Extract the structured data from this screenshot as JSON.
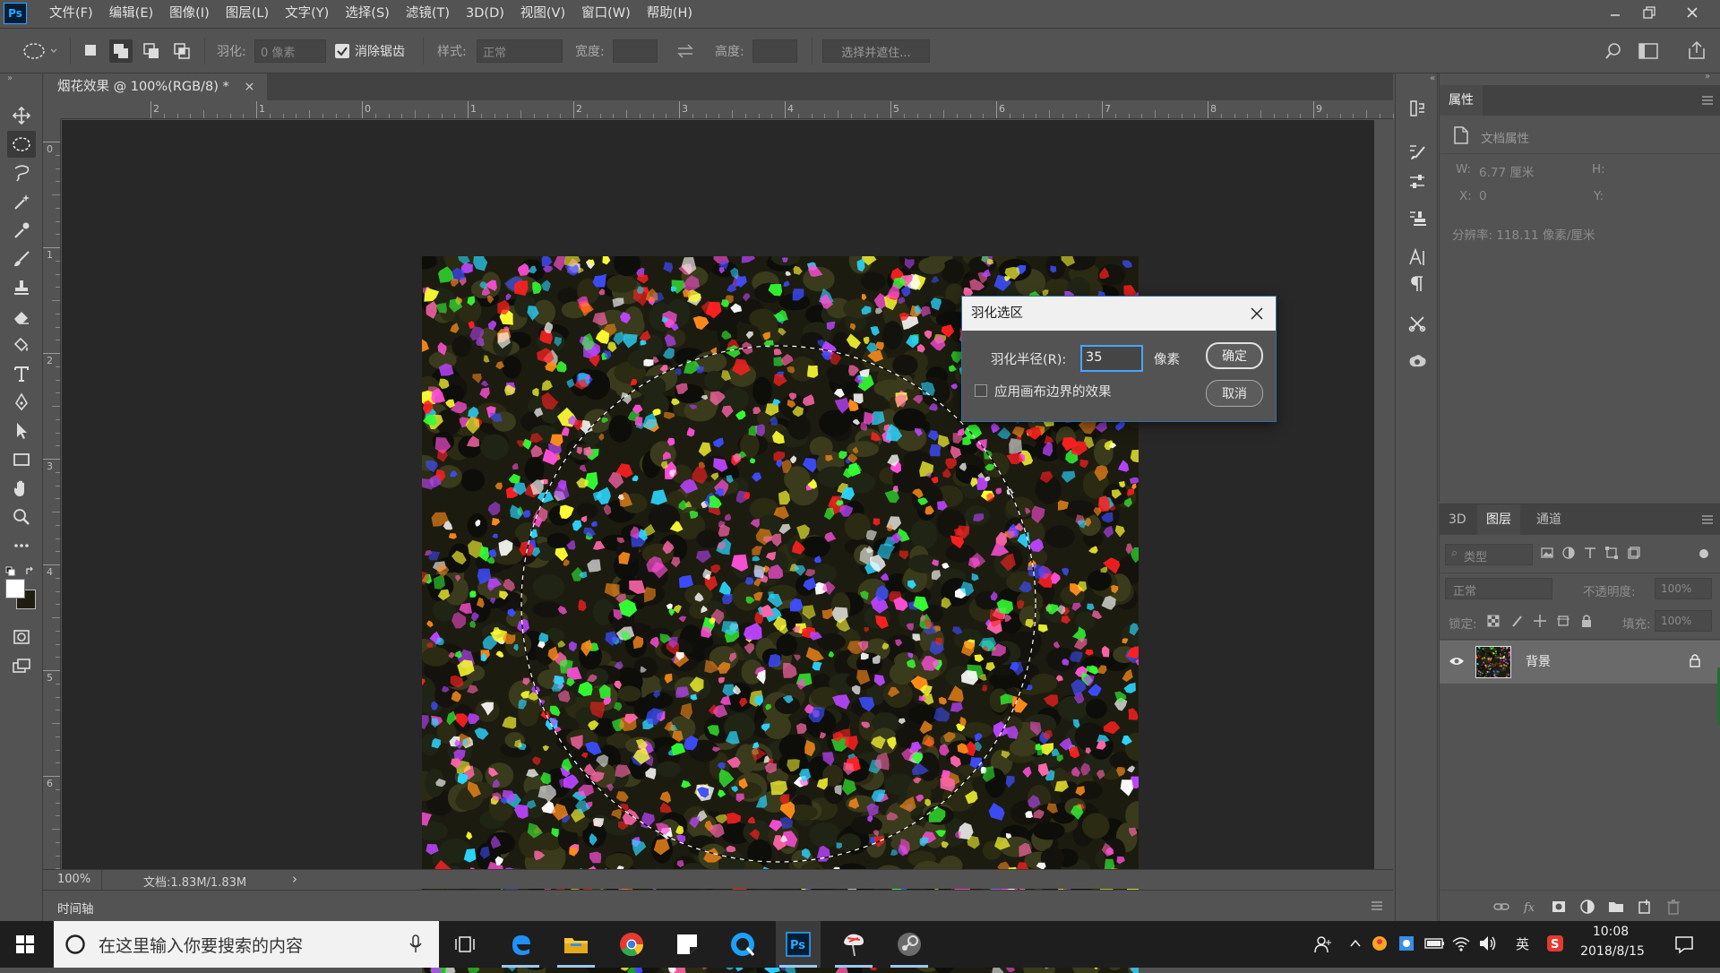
{
  "app": {
    "logo": "Ps",
    "window_controls": [
      "minimize-icon",
      "restore-icon",
      "close-icon"
    ]
  },
  "menu": [
    "文件(F)",
    "编辑(E)",
    "图像(I)",
    "图层(L)",
    "文字(Y)",
    "选择(S)",
    "滤镜(T)",
    "3D(D)",
    "视图(V)",
    "窗口(W)",
    "帮助(H)"
  ],
  "options": {
    "feather_label": "羽化:",
    "feather_value": "0 像素",
    "antialias_label": "消除锯齿",
    "antialias_checked": true,
    "style_label": "样式:",
    "style_value": "正常",
    "width_label": "宽度:",
    "height_label": "高度:",
    "select_mask_button": "选择并遮住..."
  },
  "document": {
    "tab_title": "烟花效果 @ 100%(RGB/8) *",
    "close_glyph": "×",
    "ruler_top": [
      "2",
      "1",
      "0",
      "1",
      "2",
      "3",
      "4",
      "5",
      "6",
      "7",
      "8",
      "9"
    ],
    "ruler_left": [
      "0",
      "1",
      "2",
      "3",
      "4",
      "5",
      "6"
    ]
  },
  "status": {
    "zoom": "100%",
    "doc_size": "文档:1.83M/1.83M",
    "arrow": "›"
  },
  "timeline": {
    "label": "时间轴"
  },
  "properties": {
    "tab": "属性",
    "section": "文档属性",
    "w_label": "W:",
    "w_value": "6.77 厘米",
    "h_label": "H:",
    "x_label": "X:",
    "x_value": "0",
    "y_label": "Y:",
    "resolution": "分辨率: 118.11 像素/厘米"
  },
  "layers": {
    "tabs": [
      "3D",
      "图层",
      "通道"
    ],
    "active_tab": "图层",
    "filter_kind": "类型",
    "blend_mode": "正常",
    "opacity_label": "不透明度:",
    "opacity_value": "100%",
    "lock_label": "锁定:",
    "fill_label": "填充:",
    "fill_value": "100%",
    "items": [
      {
        "name": "背景",
        "visible": true,
        "locked": true
      }
    ]
  },
  "dialog": {
    "title": "羽化选区",
    "radius_label": "羽化半径(R):",
    "radius_value": "35",
    "unit": "像素",
    "ok": "确定",
    "cancel": "取消",
    "apply_edges_label": "应用画布边界的效果",
    "apply_edges_checked": false
  },
  "taskbar": {
    "search_placeholder": "在这里输入你要搜索的内容",
    "apps": [
      "task-view-icon",
      "edge-icon",
      "file-explorer-icon",
      "chrome-icon",
      "sticky-app-icon",
      "qq-browser-icon",
      "photoshop-icon",
      "painter-icon",
      "steam-icon"
    ],
    "running": [
      "edge-icon",
      "file-explorer-icon",
      "photoshop-icon",
      "painter-icon",
      "steam-icon"
    ],
    "ime": "英",
    "time": "10:08",
    "date": "2018/8/15"
  },
  "colors": {
    "panel": "#535353",
    "canvas_bg": "#282828",
    "accent": "#31a8ff",
    "fireworks": [
      "#ffffff",
      "#ff4fd8",
      "#33ff33",
      "#2bd6ff",
      "#3d4dff",
      "#ff2020",
      "#ffff33",
      "#bb44ff",
      "#ff8c1a",
      "#ff66aa"
    ]
  }
}
